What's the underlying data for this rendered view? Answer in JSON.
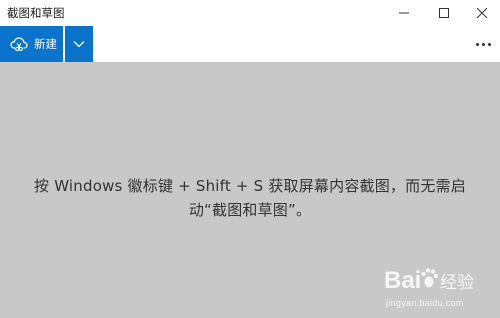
{
  "window": {
    "title": "截图和草图"
  },
  "commandbar": {
    "new_label": "新建",
    "accent_color": "#0a73cc"
  },
  "canvas": {
    "hint_line1": "按 Windows 徽标键 + Shift + S 获取屏幕内容截图，而无需启",
    "hint_line2": "动“截图和草图”。",
    "background_color": "#c8c8c8"
  },
  "watermark": {
    "brand": "Baidu经验",
    "url": "jingyan.baidu.com"
  },
  "icons": {
    "new": "cloud-scissors-icon",
    "dropdown": "chevron-down-icon",
    "more": "more-dots-icon",
    "minimize": "minimize-icon",
    "maximize": "maximize-icon",
    "close": "close-icon"
  }
}
